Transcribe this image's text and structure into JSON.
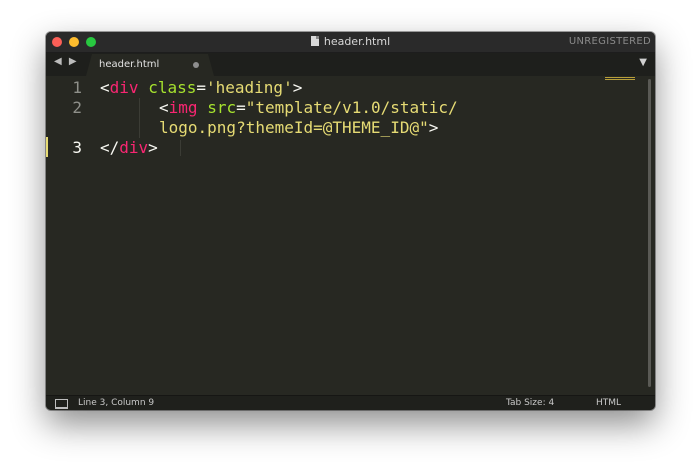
{
  "window": {
    "title": "header.html",
    "license_status": "UNREGISTERED"
  },
  "tabs": [
    {
      "label": "header.html",
      "modified": true
    }
  ],
  "editor": {
    "line_numbers": [
      "1",
      "2",
      "",
      "3"
    ],
    "active_line": "3",
    "lines": [
      {
        "line": "1",
        "tokens": [
          "<",
          "div",
          " ",
          "class",
          "=",
          "'heading'",
          ">"
        ]
      },
      {
        "line": "2",
        "tokens": [
          "<",
          "img",
          " ",
          "src",
          "=",
          "\"template/v1.0/static/"
        ]
      },
      {
        "line": "",
        "tokens": [
          "logo.png?themeId=@THEME_ID@\"",
          ">"
        ]
      },
      {
        "line": "3",
        "tokens": [
          "</",
          "div",
          ">"
        ]
      }
    ]
  },
  "statusbar": {
    "position": "Line 3, Column 9",
    "tab_size": "Tab Size: 4",
    "syntax": "HTML"
  },
  "colors": {
    "editor_background": "#272822",
    "tag": "#f92672",
    "attribute": "#a6e22e",
    "string": "#e6db74",
    "text": "#f8f8f2",
    "line_number": "#8f908a"
  },
  "icons": {
    "close": "close-icon",
    "minimize": "minimize-icon",
    "zoom": "zoom-icon",
    "document": "document-icon",
    "navigation": "tab-navigation-icons",
    "modified": "modified-dot-icon",
    "tab_menu": "tab-menu-icon",
    "panel": "panel-toggle-icon"
  }
}
